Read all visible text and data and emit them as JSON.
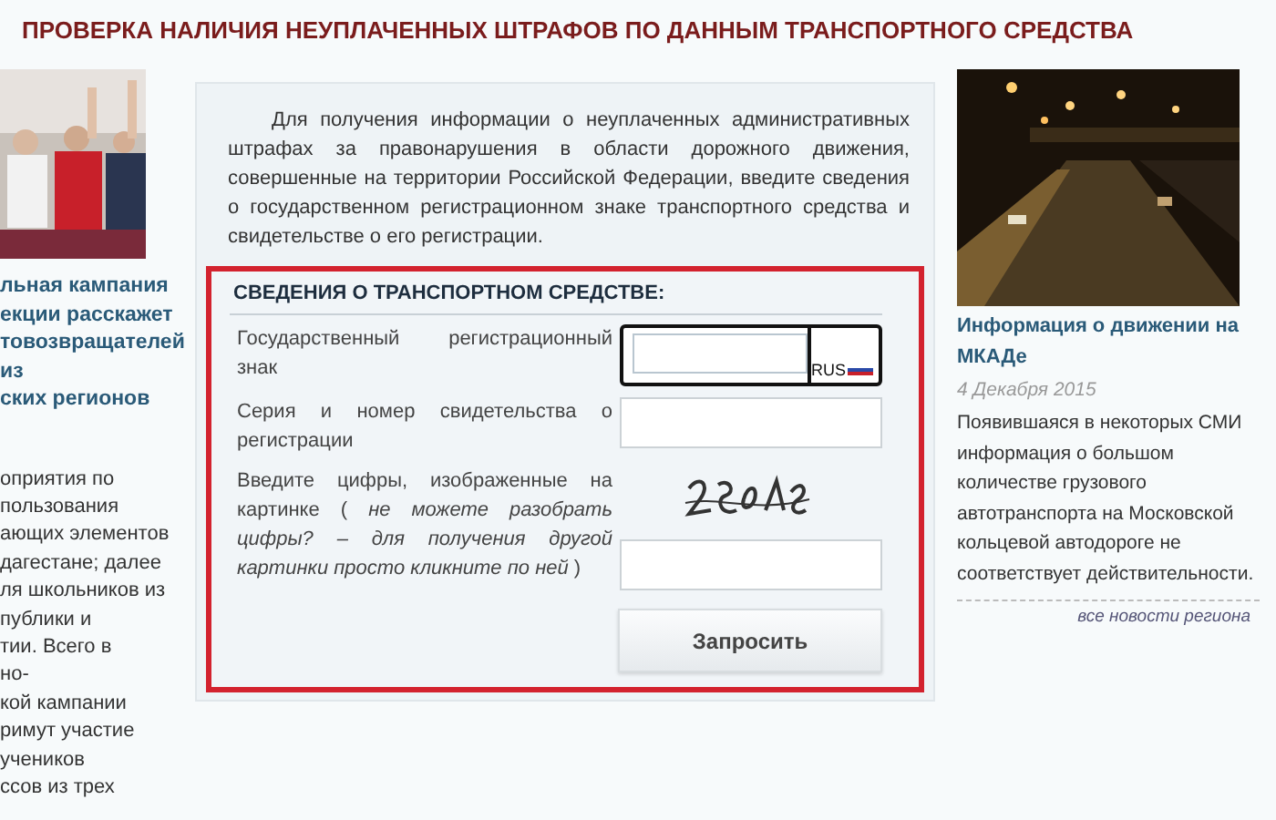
{
  "page_title": "ПРОВЕРКА НАЛИЧИЯ НЕУПЛАЧЕННЫХ ШТРАФОВ ПО ДАННЫМ ТРАНСПОРТНОГО СРЕДСТВА",
  "left_news": {
    "headline_lines": [
      "льная кампания",
      "екции расскажет",
      "товозвращателей",
      "из",
      "ских регионов"
    ],
    "body_lines": [
      "оприятия по",
      "пользования",
      "ающих элементов",
      "дагестане; далее",
      "ля школьников из",
      "публики и",
      "тии. Всего в",
      "но-",
      "кой кампании",
      "римут участие",
      "учеников",
      "ссов из трех"
    ]
  },
  "form_panel": {
    "intro": "Для получения информации о неуплаченных административных штрафах за правонарушения в области дорожного движения, совершенные на территории Российской Федерации, введите сведения о государственном регистрационном знаке транспортного средства и свидетельстве о его регистрации.",
    "section_title": "СВЕДЕНИЯ О ТРАНСПОРТНОМ СРЕДСТВЕ:",
    "fields": [
      {
        "kind": "plate",
        "label": "Государственный регистрационный знак",
        "region": "RUS"
      },
      {
        "kind": "text",
        "label": "Серия и номер свидетельства о регистрации"
      },
      {
        "kind": "captcha",
        "label": "Введите цифры, изображенные на картинке ( *не можете разобрать цифры? – для получения другой картинки просто кликните по ней* )"
      }
    ],
    "submit": "Запросить"
  },
  "right_news": {
    "headline": "Информация о движении на МКАДе",
    "date": "4 Декабря 2015",
    "body": "Появившаяся в некоторых СМИ информация о большом количестве грузового автотранспорта на Московской кольцевой автодороге не соответствует действительности.",
    "all_link": "все новости региона"
  }
}
